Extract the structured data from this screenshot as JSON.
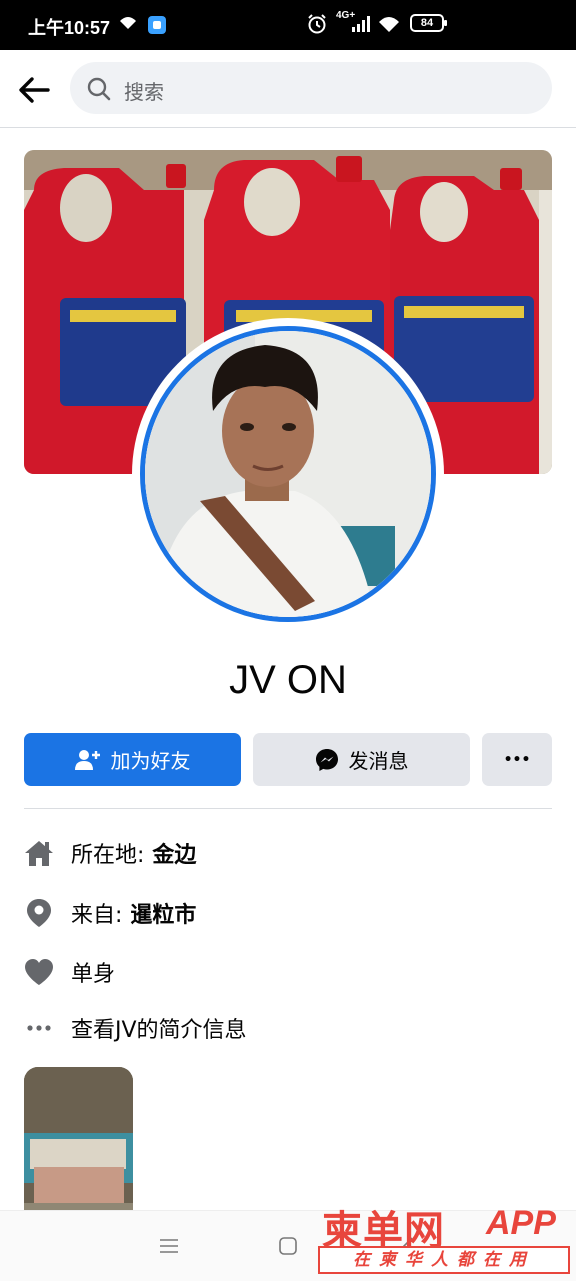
{
  "status_bar": {
    "time": "上午10:57",
    "network": "4G+",
    "battery": "84"
  },
  "search": {
    "placeholder": "搜索"
  },
  "profile": {
    "name": "JV ON"
  },
  "actions": {
    "add_friend": "加为好友",
    "message": "发消息",
    "more": "•••"
  },
  "info": {
    "lives_label": "所在地:",
    "lives_value": "金边",
    "from_label": "来自:",
    "from_value": "暹粒市",
    "relationship": "单身",
    "see_about": "查看JV的简介信息"
  },
  "watermark": {
    "brand": "柬单网",
    "app": "APP",
    "slogan": "在柬华人都在用"
  },
  "colors": {
    "accent": "#1b74e4",
    "button_gray": "#e4e6eb",
    "icon_gray": "#65676b",
    "watermark_red": "#e8453c"
  }
}
